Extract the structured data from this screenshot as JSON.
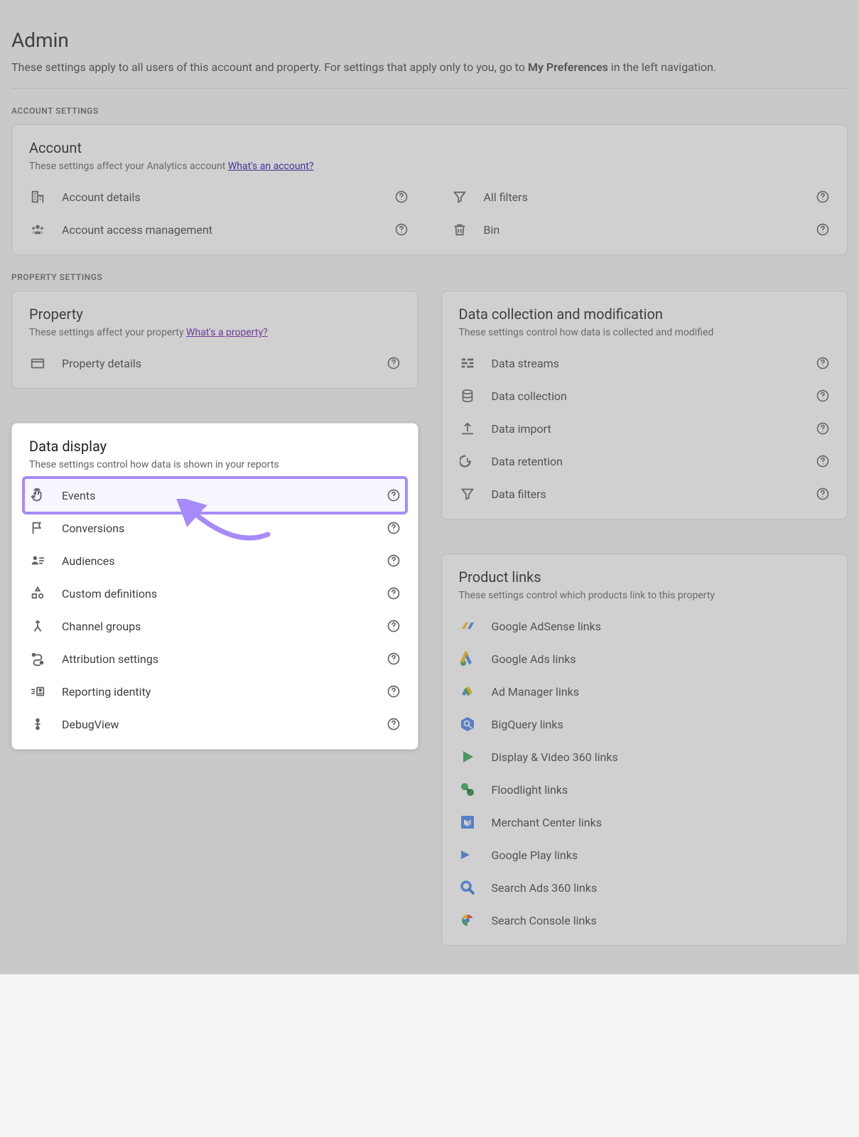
{
  "header": {
    "title": "Admin",
    "desc_pre": "These settings apply to all users of this account and property. For settings that apply only to you, go to ",
    "desc_bold": "My Preferences",
    "desc_post": " in the left navigation."
  },
  "account_section": {
    "label": "ACCOUNT SETTINGS",
    "card_title": "Account",
    "card_desc": "These settings affect your Analytics account ",
    "card_link": "What's an account?",
    "items_left": [
      {
        "label": "Account details",
        "icon": "building"
      },
      {
        "label": "Account access management",
        "icon": "people"
      }
    ],
    "items_right": [
      {
        "label": "All filters",
        "icon": "filter"
      },
      {
        "label": "Bin",
        "icon": "trash"
      }
    ]
  },
  "property_section": {
    "label": "PROPERTY SETTINGS",
    "property_card": {
      "title": "Property",
      "desc": "These settings affect your property ",
      "link": "What's a property?",
      "items": [
        {
          "label": "Property details",
          "icon": "card"
        }
      ]
    },
    "data_display_card": {
      "title": "Data display",
      "desc": "These settings control how data is shown in your reports",
      "items": [
        {
          "label": "Events",
          "icon": "touch",
          "highlight": true
        },
        {
          "label": "Conversions",
          "icon": "flag"
        },
        {
          "label": "Audiences",
          "icon": "audience"
        },
        {
          "label": "Custom definitions",
          "icon": "shapes"
        },
        {
          "label": "Channel groups",
          "icon": "merge"
        },
        {
          "label": "Attribution settings",
          "icon": "path"
        },
        {
          "label": "Reporting identity",
          "icon": "identity"
        },
        {
          "label": "DebugView",
          "icon": "debug"
        }
      ]
    },
    "data_collection_card": {
      "title": "Data collection and modification",
      "desc": "These settings control how data is collected and modified",
      "items": [
        {
          "label": "Data streams",
          "icon": "streams"
        },
        {
          "label": "Data collection",
          "icon": "database"
        },
        {
          "label": "Data import",
          "icon": "upload"
        },
        {
          "label": "Data retention",
          "icon": "retention"
        },
        {
          "label": "Data filters",
          "icon": "filter"
        }
      ]
    },
    "product_links_card": {
      "title": "Product links",
      "desc": "These settings control which products link to this property",
      "items": [
        {
          "label": "Google AdSense links",
          "icon": "adsense"
        },
        {
          "label": "Google Ads links",
          "icon": "ads"
        },
        {
          "label": "Ad Manager links",
          "icon": "admanager"
        },
        {
          "label": "BigQuery links",
          "icon": "bigquery"
        },
        {
          "label": "Display & Video 360 links",
          "icon": "dv360"
        },
        {
          "label": "Floodlight links",
          "icon": "floodlight"
        },
        {
          "label": "Merchant Center links",
          "icon": "merchant"
        },
        {
          "label": "Google Play links",
          "icon": "play"
        },
        {
          "label": "Search Ads 360 links",
          "icon": "sa360"
        },
        {
          "label": "Search Console links",
          "icon": "searchconsole"
        }
      ]
    }
  }
}
